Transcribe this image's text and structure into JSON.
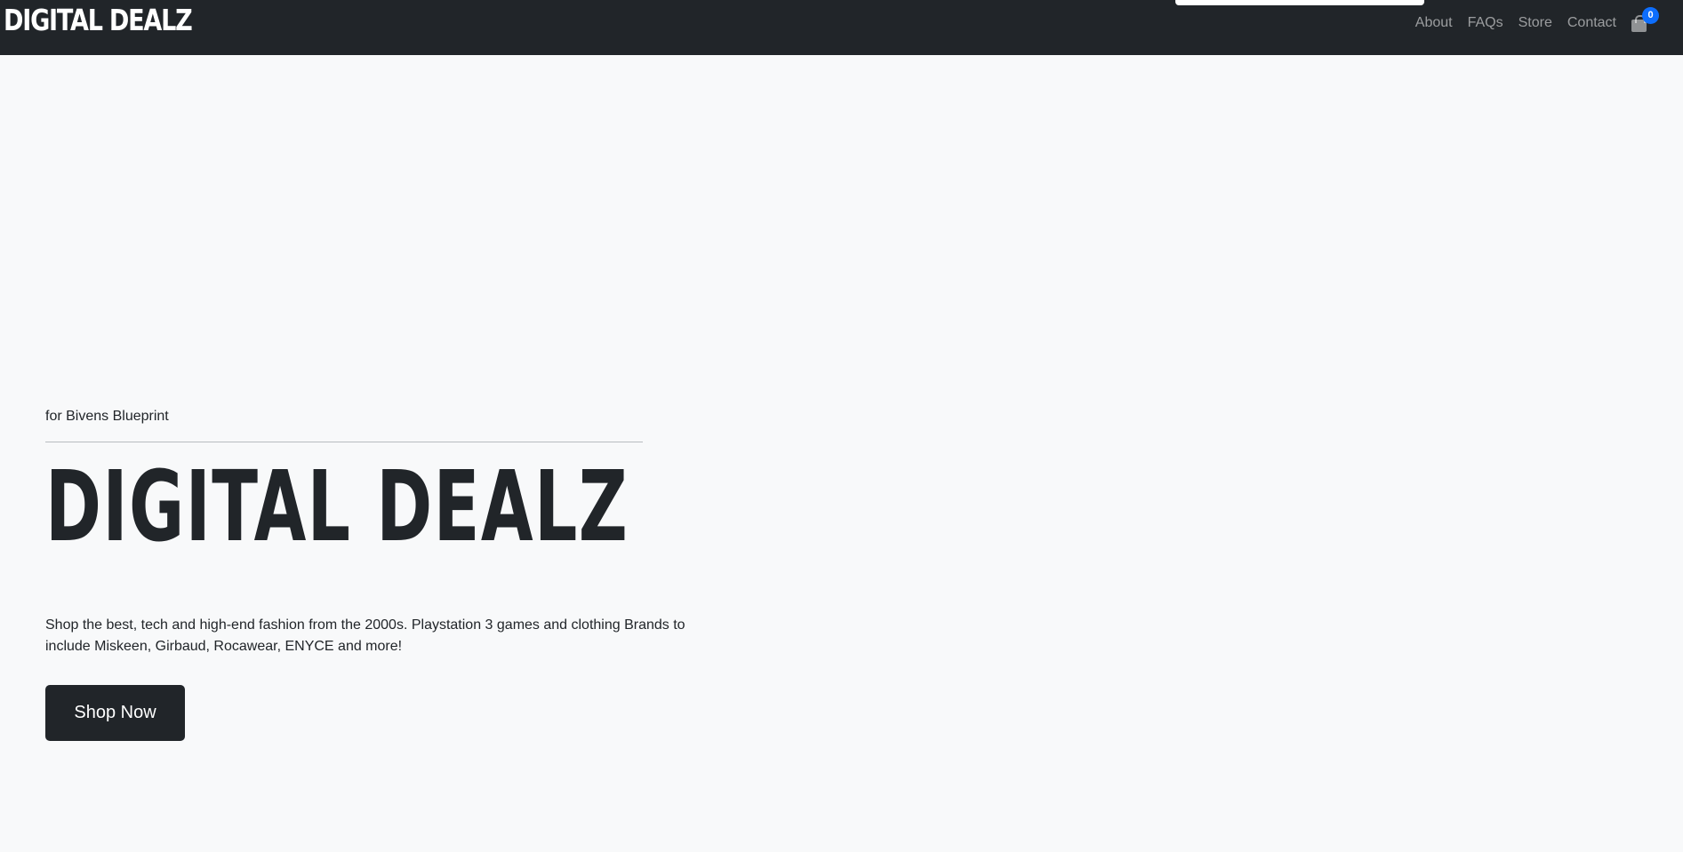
{
  "navbar": {
    "brand": "DIGITAL DEALZ",
    "links": [
      "About",
      "FAQs",
      "Store",
      "Contact"
    ],
    "cart_count": "0",
    "cart_icon": "shopping-bag-icon"
  },
  "hero": {
    "eyebrow": "for Bivens Blueprint",
    "title": "DIGITAL DEALZ",
    "description": "Shop the best, tech and high-end fashion from the 2000s. Playstation 3 games and clothing Brands to include Miskeen, Girbaud, Rocawear, ENYCE and more!",
    "cta_label": "Shop Now"
  },
  "colors": {
    "navbar_bg": "#212529",
    "page_bg": "#f8f9fa",
    "badge": "#0d6efd",
    "button_bg": "#212529"
  }
}
